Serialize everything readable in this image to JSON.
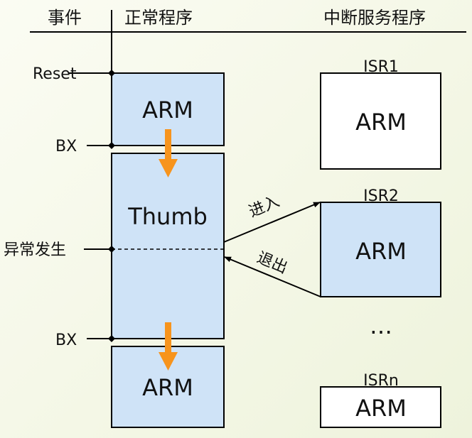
{
  "header": {
    "col_events": "事件",
    "col_normal": "正常程序",
    "col_isr": "中断服务程序"
  },
  "events": {
    "reset": "Reset",
    "bx1": "BX",
    "exception": "异常发生",
    "bx2": "BX"
  },
  "normal": {
    "arm_top": "ARM",
    "thumb": "Thumb",
    "arm_bottom": "ARM"
  },
  "isr": {
    "isr1_label": "ISR1",
    "isr1_mode": "ARM",
    "isr2_label": "ISR2",
    "isr2_mode": "ARM",
    "ellipsis": "…",
    "isrn_label": "ISRn",
    "isrn_mode": "ARM"
  },
  "arrows": {
    "enter": "进入",
    "exit": "退出"
  },
  "colors": {
    "box_fill": "#cfe3f7",
    "mode_arrow": "#f7941d",
    "line": "#000000"
  }
}
